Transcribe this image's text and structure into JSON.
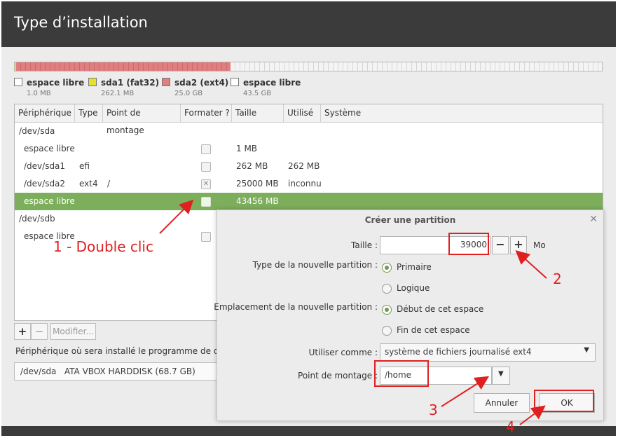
{
  "window": {
    "title": "Type d’installation"
  },
  "partition_bar": {
    "segments": [
      {
        "name": "espace libre",
        "size": "1.0 MB",
        "color": "#ffffff"
      },
      {
        "name": "sda1 (fat32)",
        "size": "262.1 MB",
        "color": "#e4e22a"
      },
      {
        "name": "sda2 (ext4)",
        "size": "25.0 GB",
        "color": "#e07f80"
      },
      {
        "name": "espace libre",
        "size": "43.5 GB",
        "color": "#ffffff"
      }
    ]
  },
  "table": {
    "headers": [
      "Périphérique",
      "Type",
      "Point de montage",
      "Formater ?",
      "Taille",
      "Utilisé",
      "Système"
    ],
    "rows": [
      {
        "device": "/dev/sda",
        "type": "",
        "mount": "",
        "format": "",
        "size": "",
        "used": "",
        "system": ""
      },
      {
        "device": "espace libre",
        "type": "",
        "mount": "",
        "format": "unchecked",
        "size": "1 MB",
        "used": "",
        "system": ""
      },
      {
        "device": "/dev/sda1",
        "type": "efi",
        "mount": "",
        "format": "unchecked",
        "size": "262 MB",
        "used": "262 MB",
        "system": ""
      },
      {
        "device": "/dev/sda2",
        "type": "ext4",
        "mount": "/",
        "format": "crossed",
        "size": "25000 MB",
        "used": "inconnu",
        "system": ""
      },
      {
        "device": "espace libre",
        "type": "",
        "mount": "",
        "format": "unchecked",
        "size": "43456 MB",
        "used": "",
        "system": ""
      },
      {
        "device": "/dev/sdb",
        "type": "",
        "mount": "",
        "format": "",
        "size": "",
        "used": "",
        "system": ""
      },
      {
        "device": "espace libre",
        "type": "",
        "mount": "",
        "format": "unchecked",
        "size": "",
        "used": "",
        "system": ""
      }
    ],
    "selected_row": 4
  },
  "toolbar": {
    "add": "+",
    "remove": "−",
    "modify": "Modifier..."
  },
  "bootloader": {
    "label": "Périphérique où sera installé le programme de dém",
    "device": "/dev/sda",
    "disk": "ATA VBOX HARDDISK (68.7 GB)"
  },
  "dialog": {
    "title": "Créer une partition",
    "close": "✕",
    "size_label": "Taille :",
    "size_value": "39000",
    "size_unit": "Mo",
    "minus": "−",
    "plus": "+",
    "type_label": "Type de la nouvelle partition :",
    "type_options": [
      "Primaire",
      "Logique"
    ],
    "type_selected": "Primaire",
    "location_label": "Emplacement de la nouvelle partition :",
    "location_options": [
      "Début de cet espace",
      "Fin de cet espace"
    ],
    "location_selected": "Début de cet espace",
    "use_as_label": "Utiliser comme :",
    "use_as_value": "système de fichiers journalisé ext4",
    "mount_label": "Point de montage :",
    "mount_value": "/home",
    "cancel": "Annuler",
    "ok": "OK"
  },
  "annotations": {
    "step1": "1 - Double clic",
    "step2": "2",
    "step3": "3",
    "step4": "4",
    "color": "#e02020"
  }
}
